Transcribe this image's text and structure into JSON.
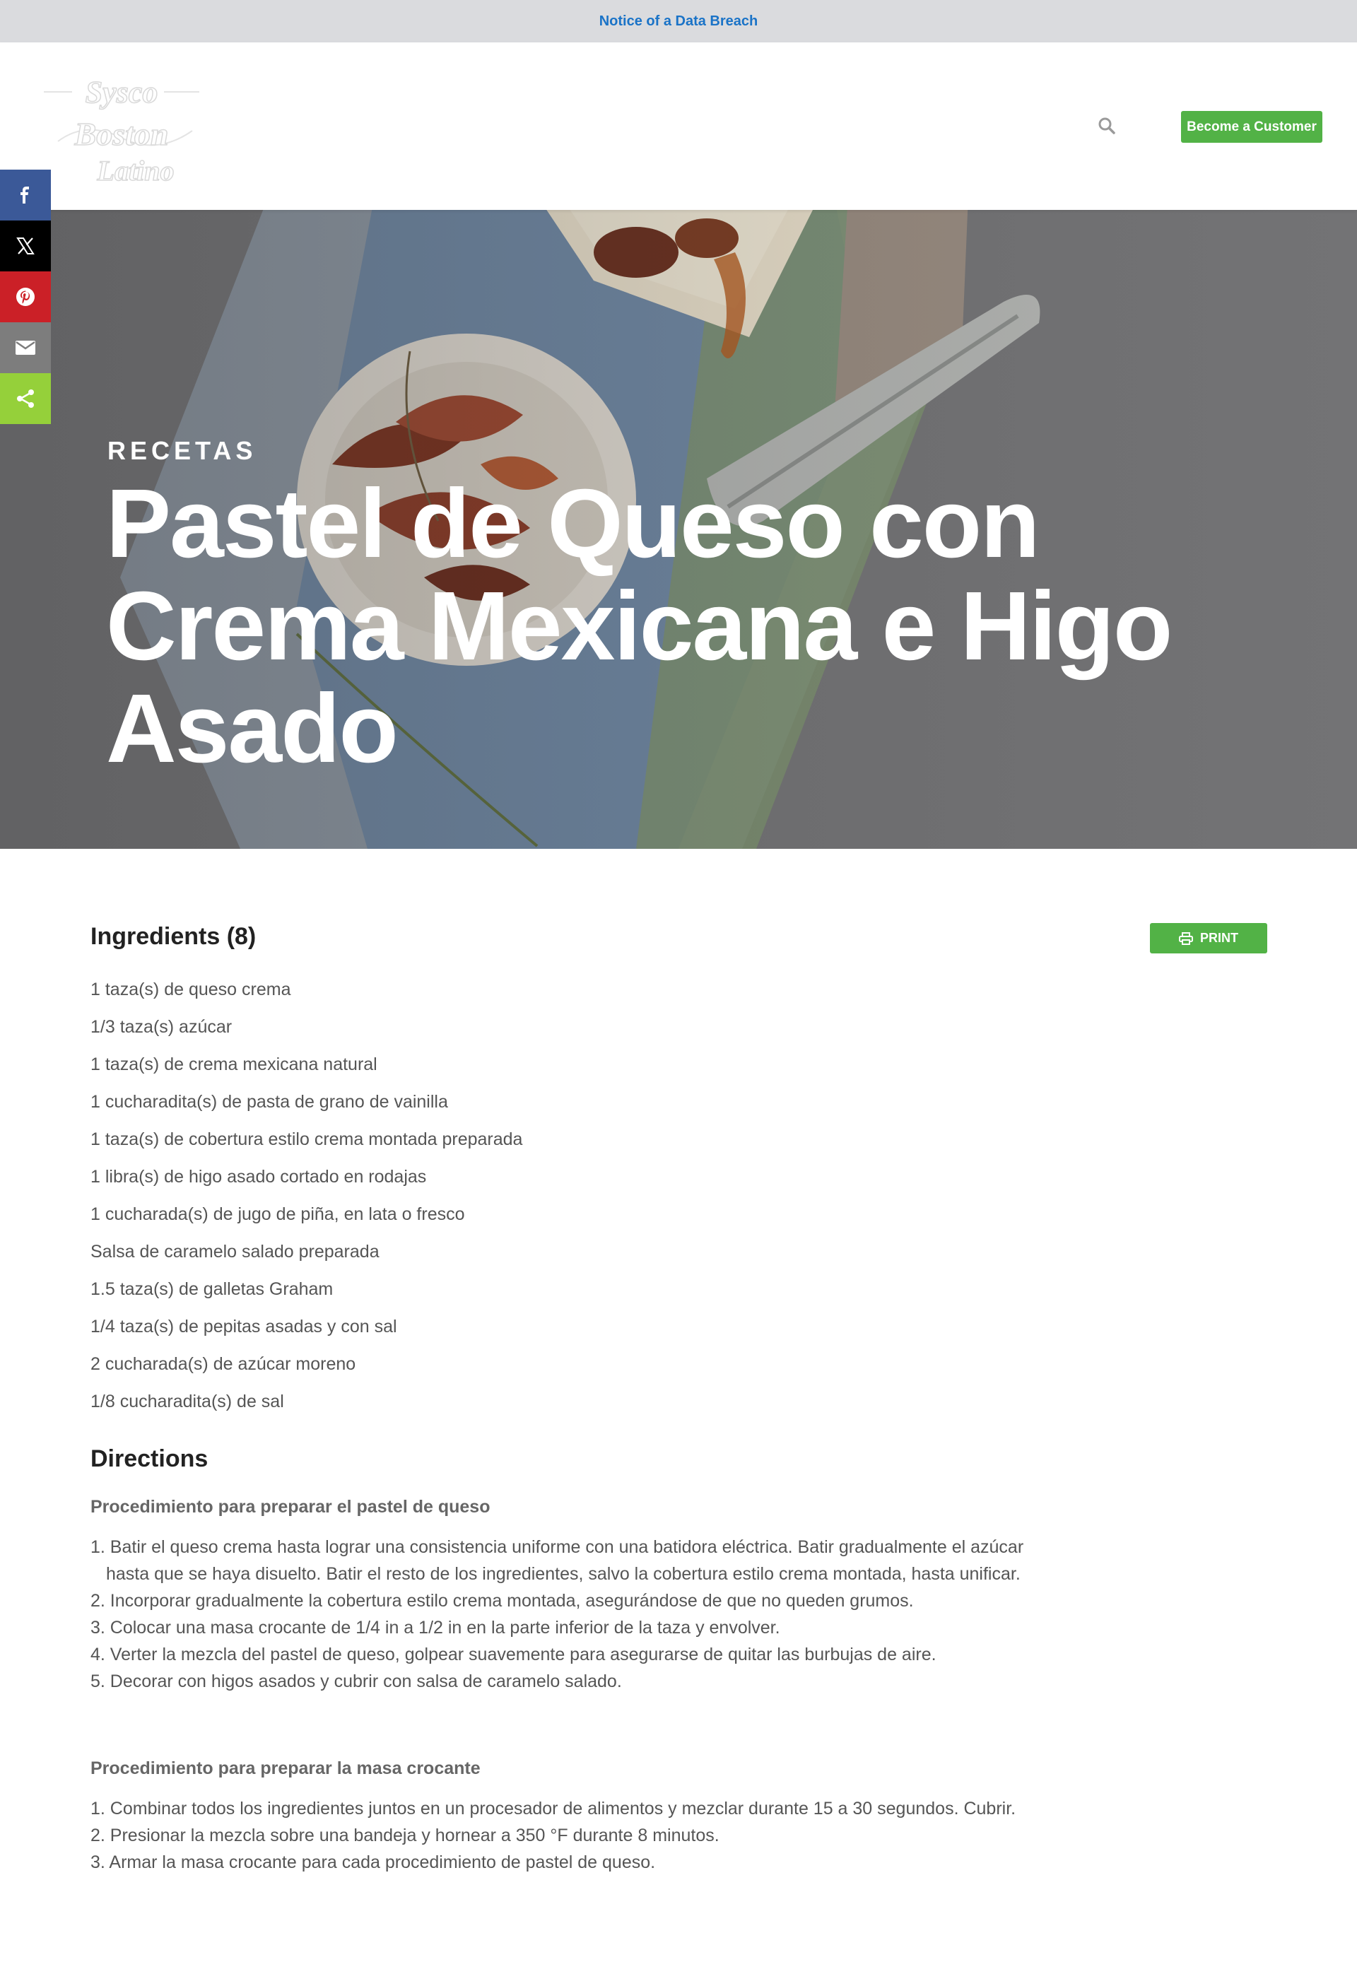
{
  "notice": {
    "label": "Notice of a Data Breach"
  },
  "header": {
    "logo_text": [
      "Sysco",
      "Boston",
      "Latino"
    ],
    "cta_label": "Become a Customer",
    "search_icon": "search-icon"
  },
  "share": {
    "items": [
      {
        "name": "facebook",
        "color": "#3b5998"
      },
      {
        "name": "x",
        "color": "#000000"
      },
      {
        "name": "pinterest",
        "color": "#cb2027"
      },
      {
        "name": "email",
        "color": "#7d7d7d"
      },
      {
        "name": "share",
        "color": "#95d03a"
      }
    ]
  },
  "hero": {
    "eyebrow": "RECETAS",
    "title": "Pastel de Queso con Crema Mexicana e Higo Asado"
  },
  "ingredients": {
    "heading": "Ingredients (8)",
    "print_label": "PRINT",
    "items": [
      "1 taza(s) de queso crema",
      "1/3 taza(s) azúcar",
      "1 taza(s) de crema mexicana natural",
      "1 cucharadita(s) de pasta de grano de vainilla",
      "1 taza(s) de cobertura estilo crema montada preparada",
      "1 libra(s) de higo asado cortado en rodajas",
      "1 cucharada(s) de jugo de piña, en lata o fresco",
      "Salsa de caramelo salado preparada",
      "1.5 taza(s) de galletas Graham",
      "1/4 taza(s) de pepitas asadas y con sal",
      "2 cucharada(s) de azúcar moreno",
      "1/8 cucharadita(s) de sal"
    ]
  },
  "directions": {
    "heading": "Directions",
    "procedures": [
      {
        "title": "Procedimiento para preparar el pastel de queso",
        "steps": [
          "1. Batir el queso crema hasta lograr una consistencia uniforme con una batidora eléctrica. Batir gradualmente el azúcar hasta que se haya disuelto. Batir el resto de los ingredientes, salvo la cobertura estilo crema montada, hasta unificar.",
          "2. Incorporar gradualmente la cobertura estilo crema montada, asegurándose de que no queden grumos.",
          "3. Colocar una masa crocante de 1/4 in a 1/2 in en la parte inferior de la taza y envolver.",
          "4. Verter la mezcla del pastel de queso, golpear suavemente para asegurarse de quitar las burbujas de aire.",
          "5. Decorar con higos asados y cubrir con salsa de caramelo salado."
        ]
      },
      {
        "title": "Procedimiento para preparar la masa crocante",
        "steps": [
          "1. Combinar todos los ingredientes juntos en un procesador de alimentos y mezclar durante 15 a 30 segundos. Cubrir.",
          "2. Presionar la mezcla sobre una bandeja y hornear a 350 °F durante 8 minutos.",
          "3. Armar la masa crocante para cada procedimiento de pastel de queso."
        ]
      }
    ]
  },
  "colors": {
    "accent_green": "#52b246",
    "link_blue": "#1a73c7"
  }
}
